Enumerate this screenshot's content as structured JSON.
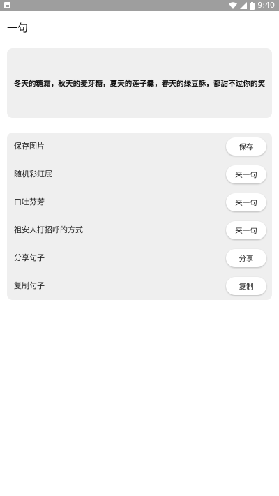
{
  "status_bar": {
    "time": "9:40",
    "icons": [
      "notification-icon",
      "wifi-icon",
      "signal-icon",
      "battery-icon"
    ],
    "background": "#9e9e9e"
  },
  "page": {
    "title": "一句"
  },
  "quote": {
    "text": "冬天的糖霜，秋天的麦芽糖，夏天的莲子羹，春天的绿豆酥，都甜不过你的笑"
  },
  "actions": [
    {
      "label": "保存图片",
      "button": "保存"
    },
    {
      "label": "随机彩虹屁",
      "button": "来一句"
    },
    {
      "label": "口吐芬芳",
      "button": "来一句"
    },
    {
      "label": "祖安人打招呼的方式",
      "button": "来一句"
    },
    {
      "label": "分享句子",
      "button": "分享"
    },
    {
      "label": "复制句子",
      "button": "复制"
    }
  ]
}
